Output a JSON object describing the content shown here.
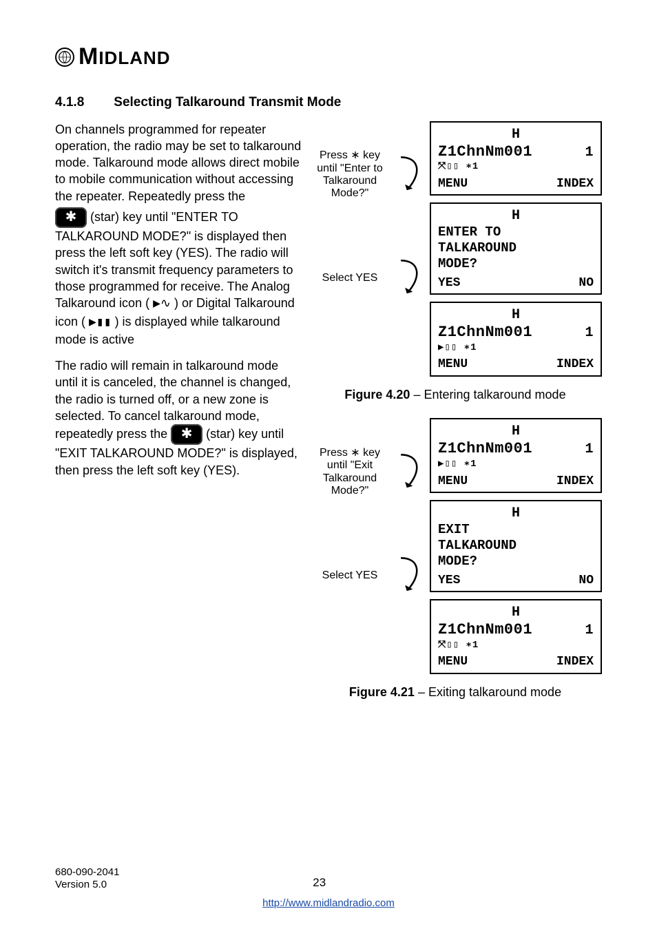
{
  "brand": "MIDLAND",
  "heading_number": "4.1.8",
  "heading_text": "Selecting Talkaround Transmit Mode",
  "para1a": "On channels programmed for repeater operation, the radio may be set to talkaround mode. Talkaround mode allows direct mobile to mobile communication without accessing the repeater. Repeatedly press the ",
  "para1b": " (star) key until \"ENTER TO TALKAROUND MODE?\" is displayed then press the left soft key (YES). The radio will switch it's transmit frequency parameters to those programmed for receive. The Analog Talkaround icon (",
  "para1c": ") or Digital Talkaround icon (",
  "para1d": ") is displayed while talkaround mode is active",
  "para2a": "The radio will remain in talkaround mode until it is canceled, the channel is changed, the radio is turned off, or a new zone is selected. To cancel talkaround mode, repeatedly press the ",
  "para2b": " (star) key until \"EXIT TALKAROUND MODE?\" is displayed, then press the left soft key (YES).",
  "analog_icon": "▶∿",
  "digital_icon": "▶▮▮",
  "steps": {
    "enter_press": "Press ∗ key until \"Enter to Talkaround Mode?\"",
    "enter_select": "Select YES",
    "exit_press": "Press ∗ key until \"Exit Talkaround Mode?\"",
    "exit_select": "Select YES"
  },
  "lcd": {
    "h": "H",
    "channel": "Z1ChnNm001",
    "one": "1",
    "small_sym1": "⤧▯▯  ∗1",
    "small_sym2": "▶▯▯  ∗1",
    "menu": "MENU",
    "index": "INDEX",
    "enter_prompt_l1": "ENTER TO",
    "enter_prompt_l2": "TALKAROUND",
    "enter_prompt_l3": "MODE?",
    "exit_prompt_l1": "EXIT",
    "exit_prompt_l2": "TALKAROUND",
    "exit_prompt_l3": "MODE?",
    "yes": "YES",
    "no": "NO"
  },
  "fig420_label": "Figure 4.20",
  "fig420_text": " – Entering talkaround mode",
  "fig421_label": "Figure 4.21",
  "fig421_text": " – Exiting talkaround mode",
  "footer": {
    "docnum": "680-090-2041",
    "version": "Version 5.0",
    "page": "23",
    "url": "http://www.midlandradio.com"
  },
  "star_glyph": "✱"
}
